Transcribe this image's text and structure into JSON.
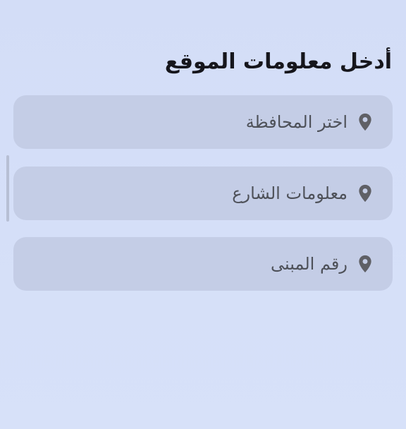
{
  "form": {
    "title": "أدخل معلومات الموقع",
    "fields": [
      {
        "placeholder": "اختر المحافظة",
        "icon": "location-pin-icon"
      },
      {
        "placeholder": "معلومات الشارع",
        "icon": "location-pin-icon"
      },
      {
        "placeholder": "رقم المبنى",
        "icon": "location-pin-icon"
      }
    ]
  },
  "colors": {
    "background": "#d6e0f8",
    "field_background": "#c4cde6",
    "title_text": "#16161c",
    "placeholder_text": "#4e5159",
    "icon": "#5f6066"
  }
}
